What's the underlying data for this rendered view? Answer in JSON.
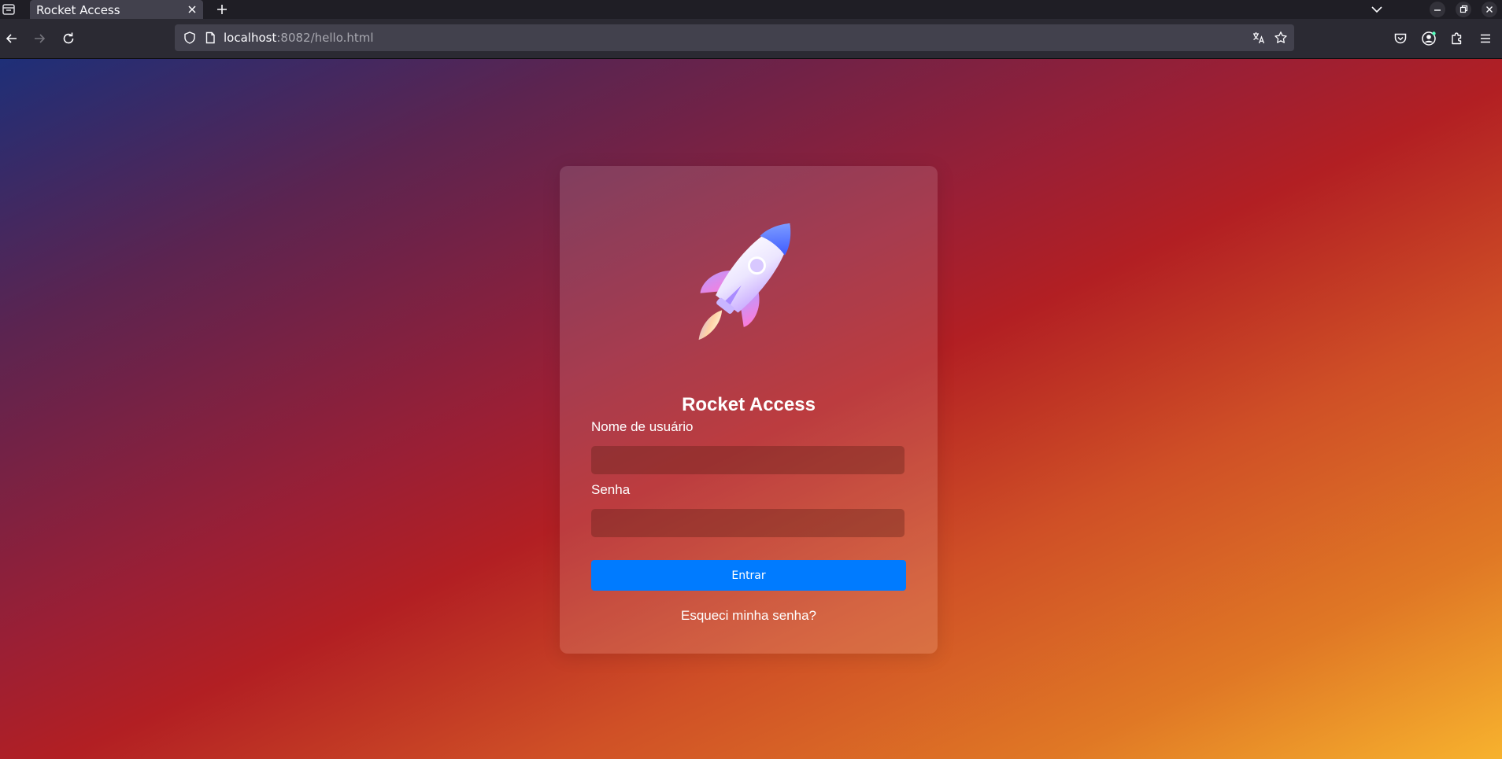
{
  "browser": {
    "tab_title": "Rocket Access",
    "url_host": "localhost",
    "url_rest": ":8082/hello.html"
  },
  "login": {
    "title": "Rocket Access",
    "username_label": "Nome de usuário",
    "username_value": "",
    "password_label": "Senha",
    "password_value": "",
    "submit_label": "Entrar",
    "forgot_label": "Esqueci minha senha?"
  },
  "colors": {
    "primary_button": "#007bff",
    "browser_chrome": "#2b2a33",
    "url_bar": "#42414d"
  },
  "icons": {
    "tab_list": "tab-list-icon",
    "close_tab": "close-icon",
    "new_tab": "plus-icon",
    "back": "arrow-left-icon",
    "forward": "arrow-right-icon",
    "reload": "reload-icon",
    "shield": "shield-icon",
    "page": "page-icon",
    "translate": "translate-icon",
    "bookmark": "star-icon",
    "pocket": "pocket-icon",
    "account": "account-icon",
    "extensions": "puzzle-icon",
    "menu": "hamburger-icon",
    "logo": "rocket-icon"
  }
}
